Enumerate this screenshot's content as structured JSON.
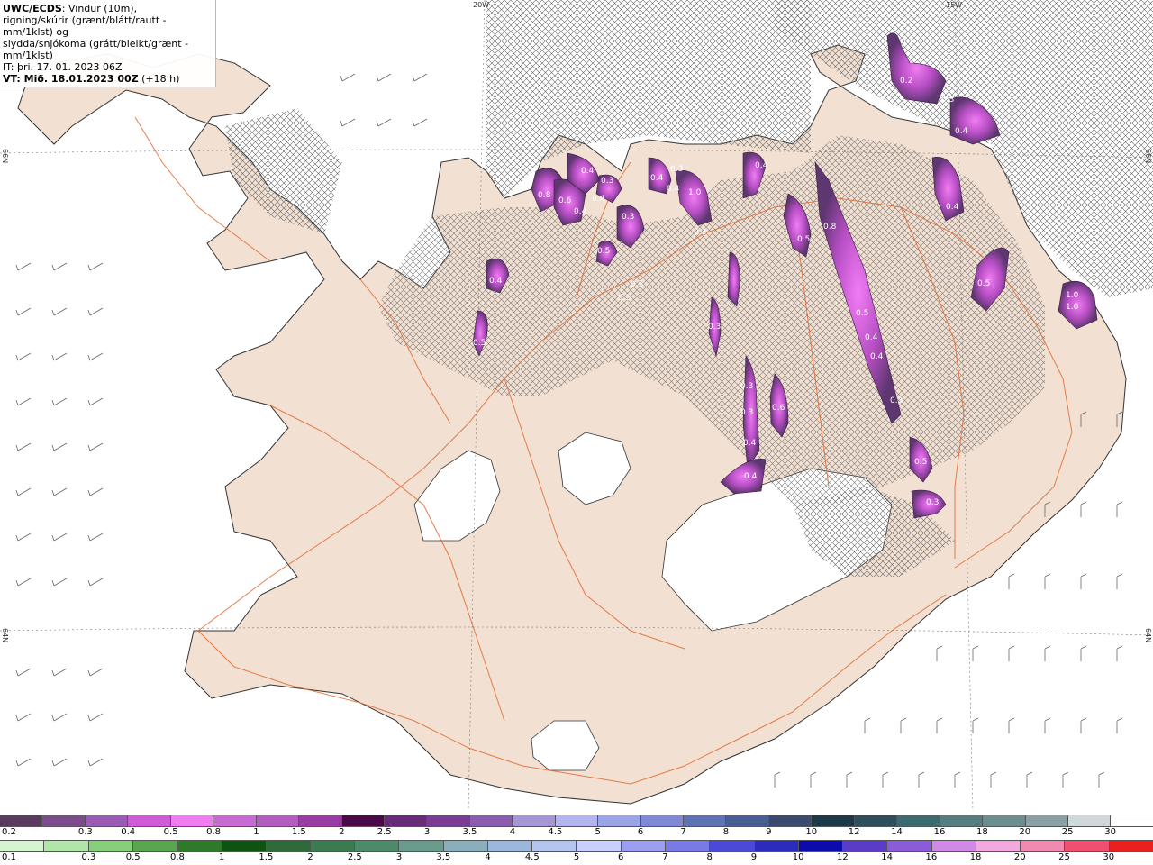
{
  "legend": {
    "line1_bold": "UWC/ECDS",
    "line1_rest": ": Vindur (10m),",
    "line2": "rigning/skúrir (grænt/blátt/rautt - mm/1klst) og",
    "line3": "slydda/snjókoma (grátt/bleikt/grænt - mm/1klst)",
    "line4": "IT: þri. 17. 01. 2023 06Z",
    "line5_bold": "VT: Mið. 18.01.2023 00Z",
    "line5_rest": " (+18 h)"
  },
  "axes": {
    "top_left": "20W",
    "top_right": "15W",
    "left_top": "66N",
    "left_bottom": "64N",
    "right_top": "66N",
    "right_bottom": "64N"
  },
  "precip_labels": [
    "0.2",
    "0.3",
    "0.4",
    "0.8",
    "0.6",
    "0.4",
    "0.3",
    "0.4",
    "0.4",
    "0.3",
    "1.0",
    "0.5",
    "0.5",
    "0.5",
    "0.3",
    "0.4",
    "0.4",
    "0.3",
    "0.4",
    "0.5",
    "1.0",
    "1.0",
    "0.4",
    "0.5",
    "0.5",
    "0.8",
    "0.5",
    "0.4",
    "0.4",
    "0.3",
    "0.3",
    "0.3",
    "0.6",
    "0.4",
    "0.4",
    "0.3",
    "0.5",
    "0.3",
    "0.4"
  ],
  "scale_snow": {
    "labels": [
      "0.2",
      "0.3",
      "0.4",
      "0.5",
      "0.8",
      "1",
      "1.5",
      "2",
      "2.5",
      "3",
      "3.5",
      "4",
      "4.5",
      "5",
      "6",
      "7",
      "8",
      "9",
      "10",
      "12",
      "14",
      "16",
      "18",
      "20",
      "25",
      "30"
    ],
    "colors": [
      "#5a3a5e",
      "#7c4c8c",
      "#9a5cb4",
      "#cf5cd6",
      "#f07cf0",
      "#c76ad4",
      "#b45cc0",
      "#9a3ca6",
      "#4a0a4a",
      "#6a2a7a",
      "#7a3c94",
      "#8c5cb0",
      "#a696d8",
      "#b4b4f0",
      "#9aa4e6",
      "#7e8ad6",
      "#6072b6",
      "#4a5e96",
      "#3a4a70",
      "#1e3a4a",
      "#2e4e5e",
      "#3c6a6e",
      "#567e7e",
      "#6c8e8e",
      "#8aa0a4",
      "#d0d8dc",
      "#ffffff"
    ]
  },
  "scale_rain": {
    "labels": [
      "0.1",
      "0.3",
      "0.5",
      "0.8",
      "1",
      "1.5",
      "2",
      "2.5",
      "3",
      "3.5",
      "4",
      "4.5",
      "5",
      "6",
      "7",
      "8",
      "9",
      "10",
      "12",
      "14",
      "16",
      "18",
      "20",
      "25",
      "30"
    ],
    "colors": [
      "#d4f5d0",
      "#b0e6a8",
      "#88cf7c",
      "#5aa650",
      "#2e7a2a",
      "#0e5410",
      "#2e6a3a",
      "#3c7a52",
      "#4c8a6a",
      "#6a9c8e",
      "#8aaebc",
      "#9cb6dc",
      "#b4c6f0",
      "#c8d0ff",
      "#9e9ef0",
      "#7a7ae6",
      "#4a4ad6",
      "#2c2cbc",
      "#0c0caa",
      "#5a3cc8",
      "#8a5cd8",
      "#d08ae6",
      "#f4a8e0",
      "#f08ab0",
      "#f05070",
      "#e82020"
    ]
  }
}
